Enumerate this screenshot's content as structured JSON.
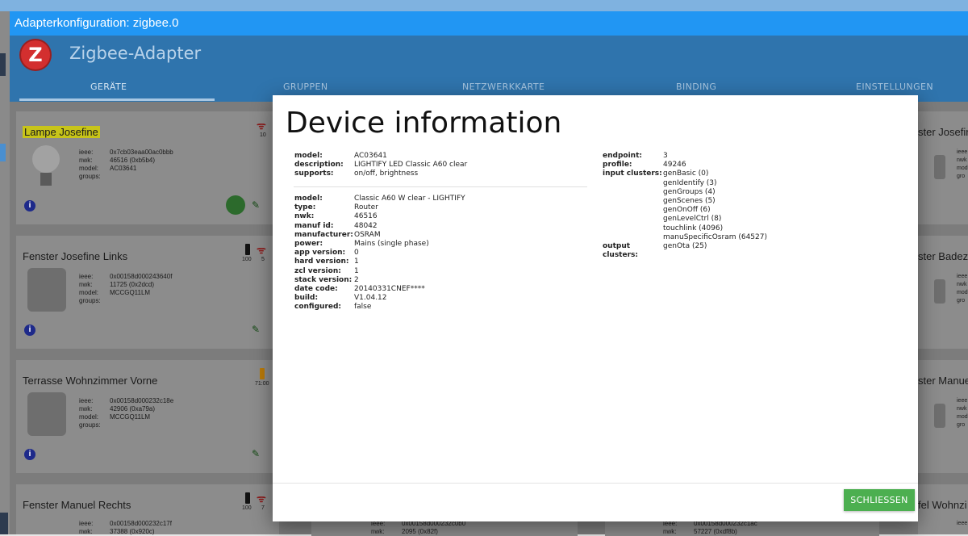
{
  "window": {
    "title": "Adapterkonfiguration: zigbee.0"
  },
  "app": {
    "logo_letter": "Z",
    "title": "Zigbee-Adapter",
    "tabs": [
      "GERÄTE",
      "GRUPPEN",
      "NETZWERKKARTE",
      "BINDING",
      "EINSTELLUNGEN"
    ]
  },
  "cards": [
    {
      "title": "Lampe Josefine",
      "ieee": "0x7cb03eaa00ac0bbb",
      "nwk": "46516 (0xb5b4)",
      "model": "AC03641",
      "groups": "",
      "link_quality": "10"
    },
    {
      "title": "Fenster Josefine Links",
      "ieee": "0x00158d000243640f",
      "nwk": "11725 (0x2dcd)",
      "model": "MCCGQ11LM",
      "groups": "",
      "battery": "100",
      "link_quality": "5"
    },
    {
      "title": "Terrasse Wohnzimmer Vorne",
      "ieee": "0x00158d000232c18e",
      "nwk": "42906 (0xa79a)",
      "model": "MCCGQ11LM",
      "groups": "",
      "battery": "71",
      "link_quality": "00"
    },
    {
      "title": "Fenster Manuel Rechts",
      "ieee": "0x00158d000232c17f",
      "nwk": "37388 (0x920c)",
      "battery": "100",
      "link_quality": "7"
    }
  ],
  "field_labels": {
    "ieee": "ieee:",
    "nwk": "nwk:",
    "model": "model:",
    "groups": "groups:"
  },
  "right_cards": [
    {
      "title": "ster Josefin",
      "fields": [
        "ieee",
        "nwk",
        "mod",
        "gro"
      ]
    },
    {
      "title": "ster Badezi",
      "fields": [
        "ieee",
        "nwk",
        "mod",
        "gro"
      ]
    },
    {
      "title": "ster Manue",
      "fields": [
        "ieee",
        "nwk",
        "mod",
        "gro"
      ]
    },
    {
      "title": "fel Wohnzi",
      "fields": [
        "ieee"
      ]
    }
  ],
  "bottom_partial": [
    {
      "ieee": "0x00158d000232c0b0",
      "nwk": "2095 (0x82f)"
    },
    {
      "ieee": "0x00158d000232c1ac",
      "nwk": "57227 (0xdf8b)"
    }
  ],
  "modal": {
    "title": "Device information",
    "close_label": "SCHLIESSEN",
    "summary": [
      {
        "key": "model:",
        "value": "AC03641"
      },
      {
        "key": "description:",
        "value": "LIGHTIFY LED Classic A60 clear"
      },
      {
        "key": "supports:",
        "value": "on/off, brightness"
      }
    ],
    "details": [
      {
        "key": "model:",
        "value": "Classic A60 W clear - LIGHTIFY"
      },
      {
        "key": "type:",
        "value": "Router"
      },
      {
        "key": "nwk:",
        "value": "46516"
      },
      {
        "key": "manuf id:",
        "value": "48042"
      },
      {
        "key": "manufacturer:",
        "value": "OSRAM"
      },
      {
        "key": "power:",
        "value": "Mains (single phase)"
      },
      {
        "key": "app version:",
        "value": "0"
      },
      {
        "key": "hard version:",
        "value": "1"
      },
      {
        "key": "zcl version:",
        "value": "1"
      },
      {
        "key": "stack version:",
        "value": "2"
      },
      {
        "key": "date code:",
        "value": "20140331CNEF****"
      },
      {
        "key": "build:",
        "value": "V1.04.12"
      },
      {
        "key": "configured:",
        "value": "false"
      }
    ],
    "endpoint": {
      "endpoint_label": "endpoint:",
      "endpoint": "3",
      "profile_label": "profile:",
      "profile": "49246",
      "input_label": "input clusters:",
      "input_clusters": [
        "genBasic (0)",
        "genIdentify (3)",
        "genGroups (4)",
        "genScenes (5)",
        "genOnOff (6)",
        "genLevelCtrl (8)",
        "touchlink (4096)",
        "manuSpecificOsram (64527)"
      ],
      "output_label": "output clusters:",
      "output_clusters": [
        "genOta (25)"
      ]
    }
  },
  "colors": {
    "titlebar": "#2196f3",
    "header": "#2f74ad",
    "accent_button": "#4caf50",
    "highlight": "#c7c419"
  }
}
